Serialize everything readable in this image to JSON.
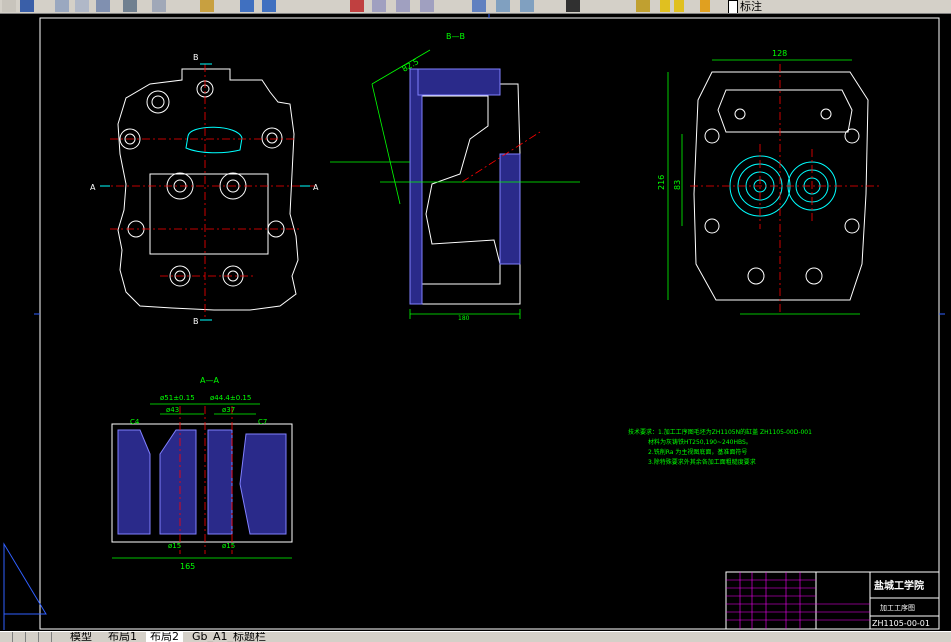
{
  "toolbar": {
    "layer_name": "标注"
  },
  "drawing": {
    "section_bb": "B—B",
    "section_aa": "A—A",
    "label_a": "A",
    "label_b": "B",
    "dim_128": "128",
    "dim_216": "216",
    "dim_83": "83",
    "dim_165": "165",
    "dim_180": "180",
    "dim_82_5": "82.5",
    "dim_d51": "ø51±0.15",
    "dim_d43": "ø43",
    "dim_d44": "ø44.4±0.15",
    "dim_d37": "ø37",
    "dim_d15a": "ø15",
    "dim_d15b": "ø15",
    "dim_c4": "C4",
    "dim_c7": "C7",
    "notes": [
      "技术要求：1.加工工序图毛坯为ZH1105N的缸盖 ZH1105-00D-001",
      "材料为灰铸铁HT250,190~240HBS。",
      "2.铣削Ra   为主视图底面，基准面符号",
      "3.除特殊要求外其余各加工面粗糙度要求"
    ]
  },
  "title_block": {
    "school": "盐城工学院",
    "drawing_name": "加工工序图",
    "drawing_no": "ZH1105-00-01"
  },
  "tabs": [
    {
      "label": "模型",
      "active": false
    },
    {
      "label": "布局1",
      "active": false
    },
    {
      "label": "布局2",
      "active": true
    },
    {
      "label": "Gb_A1_标题栏",
      "active": false
    }
  ]
}
